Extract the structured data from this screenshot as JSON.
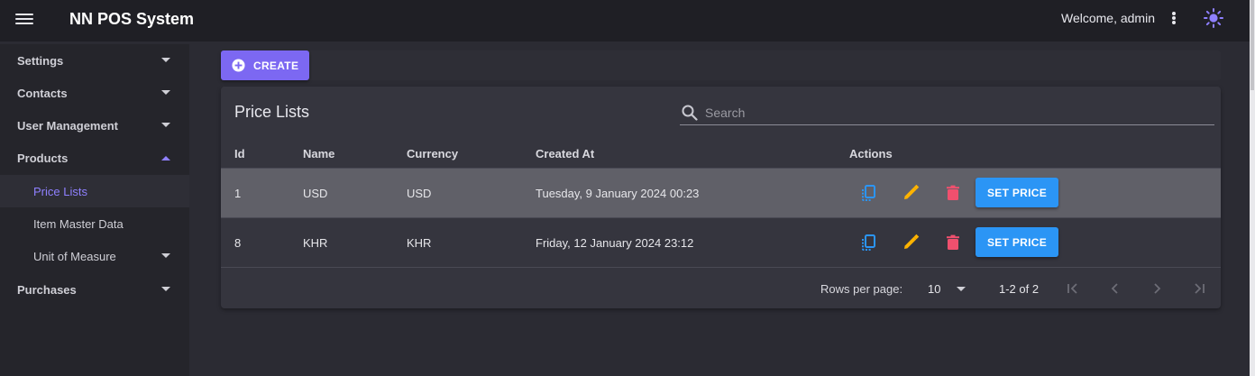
{
  "app": {
    "title": "NN POS System",
    "welcome": "Welcome, admin",
    "menu_icon": "hamburger-menu-icon",
    "more_icon": "more-vert-icon",
    "theme_icon": "sun-theme-icon"
  },
  "colors": {
    "accent": "#7c68f2",
    "primary_button": "#2b95f5",
    "copy_icon": "#2b95f5",
    "edit_icon": "#ffb300",
    "delete_icon": "#f0506e",
    "active_nav": "#8f80ff"
  },
  "sidebar": {
    "items": [
      {
        "label": "Settings",
        "expanded": false
      },
      {
        "label": "Contacts",
        "expanded": false
      },
      {
        "label": "User Management",
        "expanded": false
      },
      {
        "label": "Products",
        "expanded": true
      },
      {
        "label": "Price Lists",
        "active": true
      },
      {
        "label": "Item Master Data"
      },
      {
        "label": "Unit of Measure",
        "expanded": false
      },
      {
        "label": "Purchases",
        "expanded": false
      }
    ]
  },
  "toolbar": {
    "create_label": "CREATE",
    "create_icon": "plus-circle-icon"
  },
  "card": {
    "title": "Price Lists",
    "search_placeholder": "Search",
    "search_value": ""
  },
  "table": {
    "columns": [
      "Id",
      "Name",
      "Currency",
      "Created At",
      "Actions"
    ],
    "rows": [
      {
        "id": "1",
        "name": "USD",
        "currency": "USD",
        "created_at": "Tuesday, 9 January 2024 00:23"
      },
      {
        "id": "8",
        "name": "KHR",
        "currency": "KHR",
        "created_at": "Friday, 12 January 2024 23:12"
      }
    ],
    "action_button_label": "SET PRICE",
    "action_icons": [
      "copy-icon",
      "edit-icon",
      "delete-icon"
    ]
  },
  "pagination": {
    "rows_per_page_label": "Rows per page:",
    "rows_per_page": "10",
    "range": "1-2 of 2"
  }
}
